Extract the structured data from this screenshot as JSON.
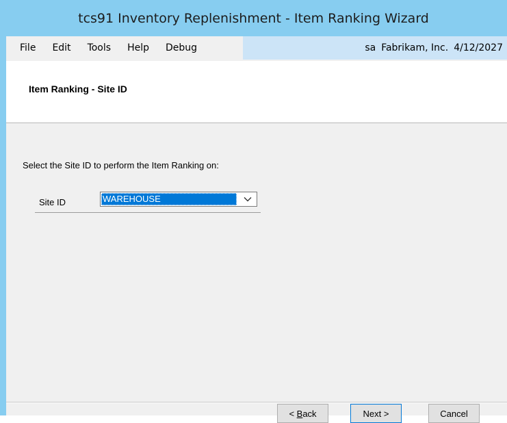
{
  "window": {
    "title": "tcs91 Inventory Replenishment - Item Ranking Wizard"
  },
  "menu": {
    "items": [
      "File",
      "Edit",
      "Tools",
      "Help",
      "Debug"
    ]
  },
  "status": {
    "user": "sa",
    "company": "Fabrikam, Inc.",
    "date": "4/12/2027"
  },
  "header": {
    "title": "Item Ranking - Site ID"
  },
  "form": {
    "instructions": "Select the Site ID to perform the Item Ranking on:",
    "site_label": "Site ID",
    "site_value": "WAREHOUSE"
  },
  "buttons": {
    "back_prefix": "< ",
    "back_accel": "B",
    "back_rest": "ack",
    "next": "Next >",
    "cancel": "Cancel"
  },
  "colors": {
    "title_bar": "#87cdf0",
    "selection": "#0078d7",
    "menu_info_bg": "#cce4f7"
  }
}
